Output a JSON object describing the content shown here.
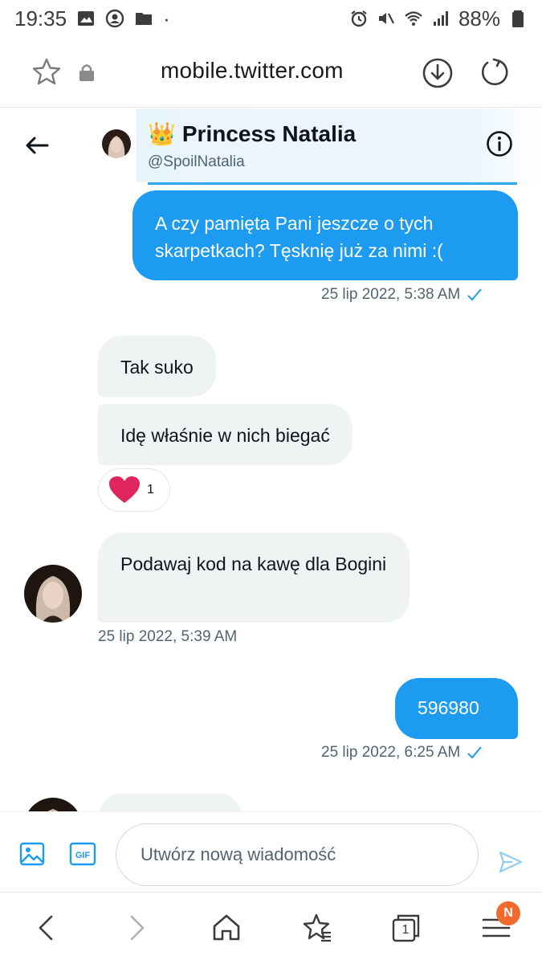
{
  "status_bar": {
    "time": "19:35",
    "battery": "88%",
    "dot": "·"
  },
  "browser": {
    "url": "mobile.twitter.com"
  },
  "conversation": {
    "name": "Princess Natalia",
    "crown_emoji": "👑",
    "handle": "@SpoilNatalia"
  },
  "messages": [
    {
      "direction": "out",
      "text": "A czy pamięta Pani jeszcze o tych skarpetkach? Tęsknię już za nimi :(",
      "timestamp": "25 lip 2022, 5:38 AM"
    },
    {
      "direction": "in",
      "text": "Tak suko"
    },
    {
      "direction": "in",
      "text": "Idę właśnie w nich biegać",
      "reaction_count": "1"
    },
    {
      "direction": "in",
      "text": "Podawaj kod na kawę dla Bogini",
      "timestamp": "25 lip 2022, 5:39 AM"
    },
    {
      "direction": "out",
      "text": "596980",
      "timestamp": "25 lip 2022, 6:25 AM"
    }
  ],
  "compose": {
    "placeholder": "Utwórz nową wiadomość"
  },
  "nav": {
    "tabs_count": "1",
    "badge": "N"
  },
  "colors": {
    "accent": "#1d9bf0",
    "bubble_in": "#eff3f4",
    "reaction_heart": "#e0245e",
    "badge": "#f16a2d"
  }
}
